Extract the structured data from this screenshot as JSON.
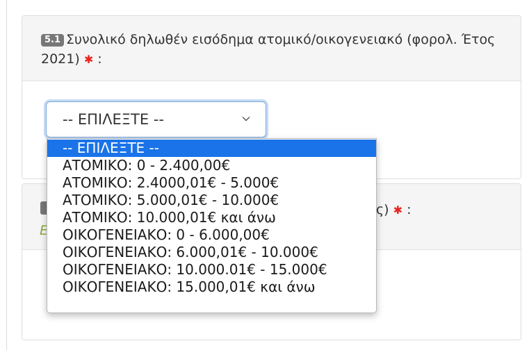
{
  "question": {
    "badge": "5.1",
    "text": "Συνολικό δηλωθέν εισόδημα ατομικό/οικογενειακό (φορολ. Έτος 2021)",
    "required_mark": "✱",
    "suffix": " :"
  },
  "select": {
    "value": "-- ΕΠΙΛΕΞΤΕ --",
    "options": [
      "-- ΕΠΙΛΕΞΤΕ --",
      "ΑΤΟΜΙΚΟ: 0 - 2.400,00€",
      "ΑΤΟΜΙΚΟ: 2.4000,01€ - 5.000€",
      "ΑΤΟΜΙΚΟ: 5.000,01€ - 10.000€",
      "ΑΤΟΜΙΚΟ: 10.000,01€ και άνω",
      "ΟΙΚΟΓΕΝΕΙΑΚΟ: 0 - 6.000,00€",
      "ΟΙΚΟΓΕΝΕΙΑΚΟ: 6.000,01€ - 10.000€",
      "ΟΙΚΟΓΕΝΕΙΑΚΟ: 10.000.01€ - 15.000€",
      "ΟΙΚΟΓΕΝΕΙΑΚΟ: 15.000,01€ και άνω"
    ],
    "selected_index": 0
  },
  "next_question": {
    "visible_tail": "ς)",
    "required_mark": "✱",
    "suffix": " :",
    "green_fragment": "Ε"
  },
  "colors": {
    "highlight": "#1a73e8",
    "badge": "#777777",
    "required": "#e8251f",
    "focus_ring": "#c5dbf3"
  }
}
